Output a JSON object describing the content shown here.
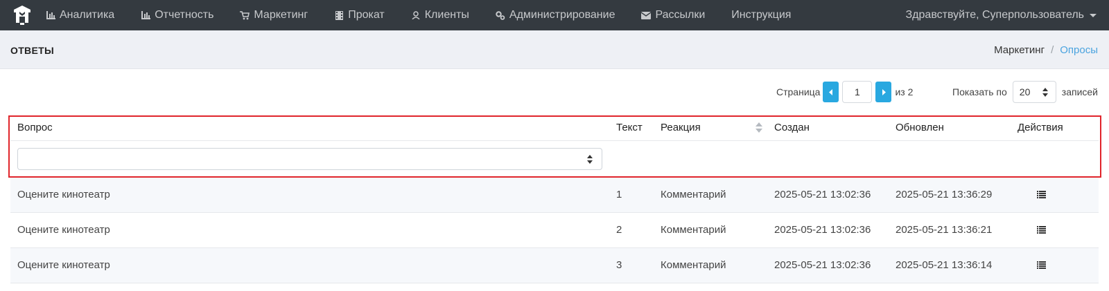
{
  "navbar": {
    "logo": "app-logo",
    "items": [
      {
        "label": "Аналитика",
        "icon": "bar-chart-icon"
      },
      {
        "label": "Отчетность",
        "icon": "bar-chart-icon"
      },
      {
        "label": "Маркетинг",
        "icon": "cart-icon"
      },
      {
        "label": "Прокат",
        "icon": "film-icon"
      },
      {
        "label": "Клиенты",
        "icon": "user-icon"
      },
      {
        "label": "Администрирование",
        "icon": "gears-icon"
      },
      {
        "label": "Рассылки",
        "icon": "envelope-icon"
      },
      {
        "label": "Инструкция",
        "icon": ""
      }
    ],
    "user_greeting": "Здравствуйте, Суперпользователь"
  },
  "header": {
    "title": "ОТВЕТЫ",
    "breadcrumb": {
      "parent": "Маркетинг",
      "separator": "/",
      "current": "Опросы"
    }
  },
  "pagination": {
    "page_label": "Страница",
    "current_page": "1",
    "of_label": "из 2",
    "show_label": "Показать по",
    "page_size": "20",
    "records_label": "записей"
  },
  "table": {
    "columns": [
      "Вопрос",
      "Текст",
      "Реакция",
      "Создан",
      "Обновлен",
      "Действия"
    ],
    "filter_value": "",
    "rows": [
      {
        "question": "Оцените кинотеатр",
        "text": "1",
        "reaction": "Комментарий",
        "created": "2025-05-21 13:02:36",
        "updated": "2025-05-21 13:36:29",
        "action_icon": "list-icon"
      },
      {
        "question": "Оцените кинотеатр",
        "text": "2",
        "reaction": "Комментарий",
        "created": "2025-05-21 13:02:36",
        "updated": "2025-05-21 13:36:21",
        "action_icon": "list-icon"
      },
      {
        "question": "Оцените кинотеатр",
        "text": "3",
        "reaction": "Комментарий",
        "created": "2025-05-21 13:02:36",
        "updated": "2025-05-21 13:36:14",
        "action_icon": "list-icon"
      }
    ]
  },
  "colors": {
    "navbar_bg": "#343a40",
    "accent": "#29a8e0",
    "highlight_border": "#e0252b"
  }
}
